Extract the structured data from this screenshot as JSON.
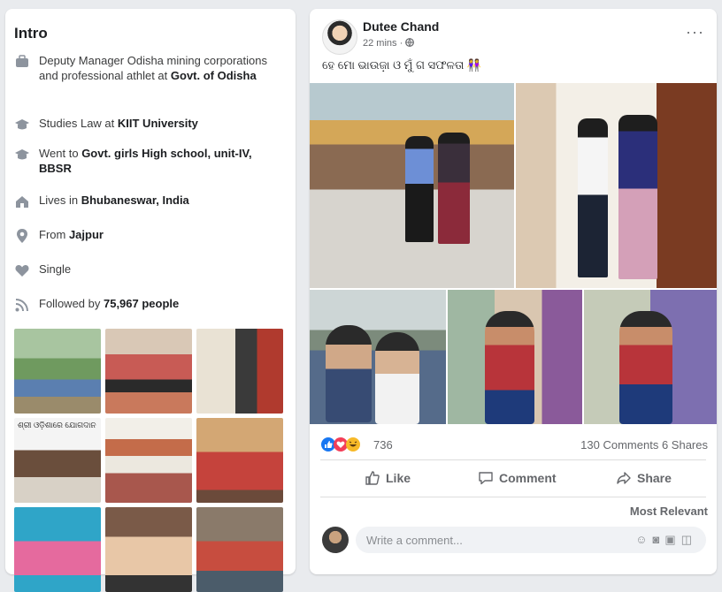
{
  "intro": {
    "title": "Intro",
    "work_prefix": "Deputy Manager Odisha mining corporations and professional athlet at ",
    "work_place": "Govt. of Odisha",
    "study_prefix": "Studies Law at ",
    "study_place": "KIIT University",
    "school_prefix": "Went to ",
    "school_place": "Govt. girls High school, unit-IV, BBSR",
    "lives_prefix": "Lives in ",
    "lives_place": "Bhubaneswar, India",
    "from_prefix": "From ",
    "from_place": "Jajpur",
    "relationship": "Single",
    "followers_prefix": "Followed by ",
    "followers_count": "75,967 people",
    "thumb_caption": "ଶ୍ରୀ ଓଡ଼ିଶାରେ ଯୋଗଦାନ"
  },
  "post": {
    "author": "Dutee Chand",
    "time": "22 mins · ",
    "text": "ହେ ମୋ ଭାଉଜ଼ା ଓ ମୁଁ ଗ ସଫଳତା 👭",
    "more": "···",
    "reaction_count": "736",
    "comments": "130 Comments",
    "shares": "6 Shares",
    "like_label": "Like",
    "comment_label": "Comment",
    "share_label": "Share",
    "sort_label": "Most Relevant",
    "comment_placeholder": "Write a comment..."
  },
  "colors": {
    "blue": "#1877f2",
    "bg": "#e9ebee",
    "muted": "#65676b"
  }
}
